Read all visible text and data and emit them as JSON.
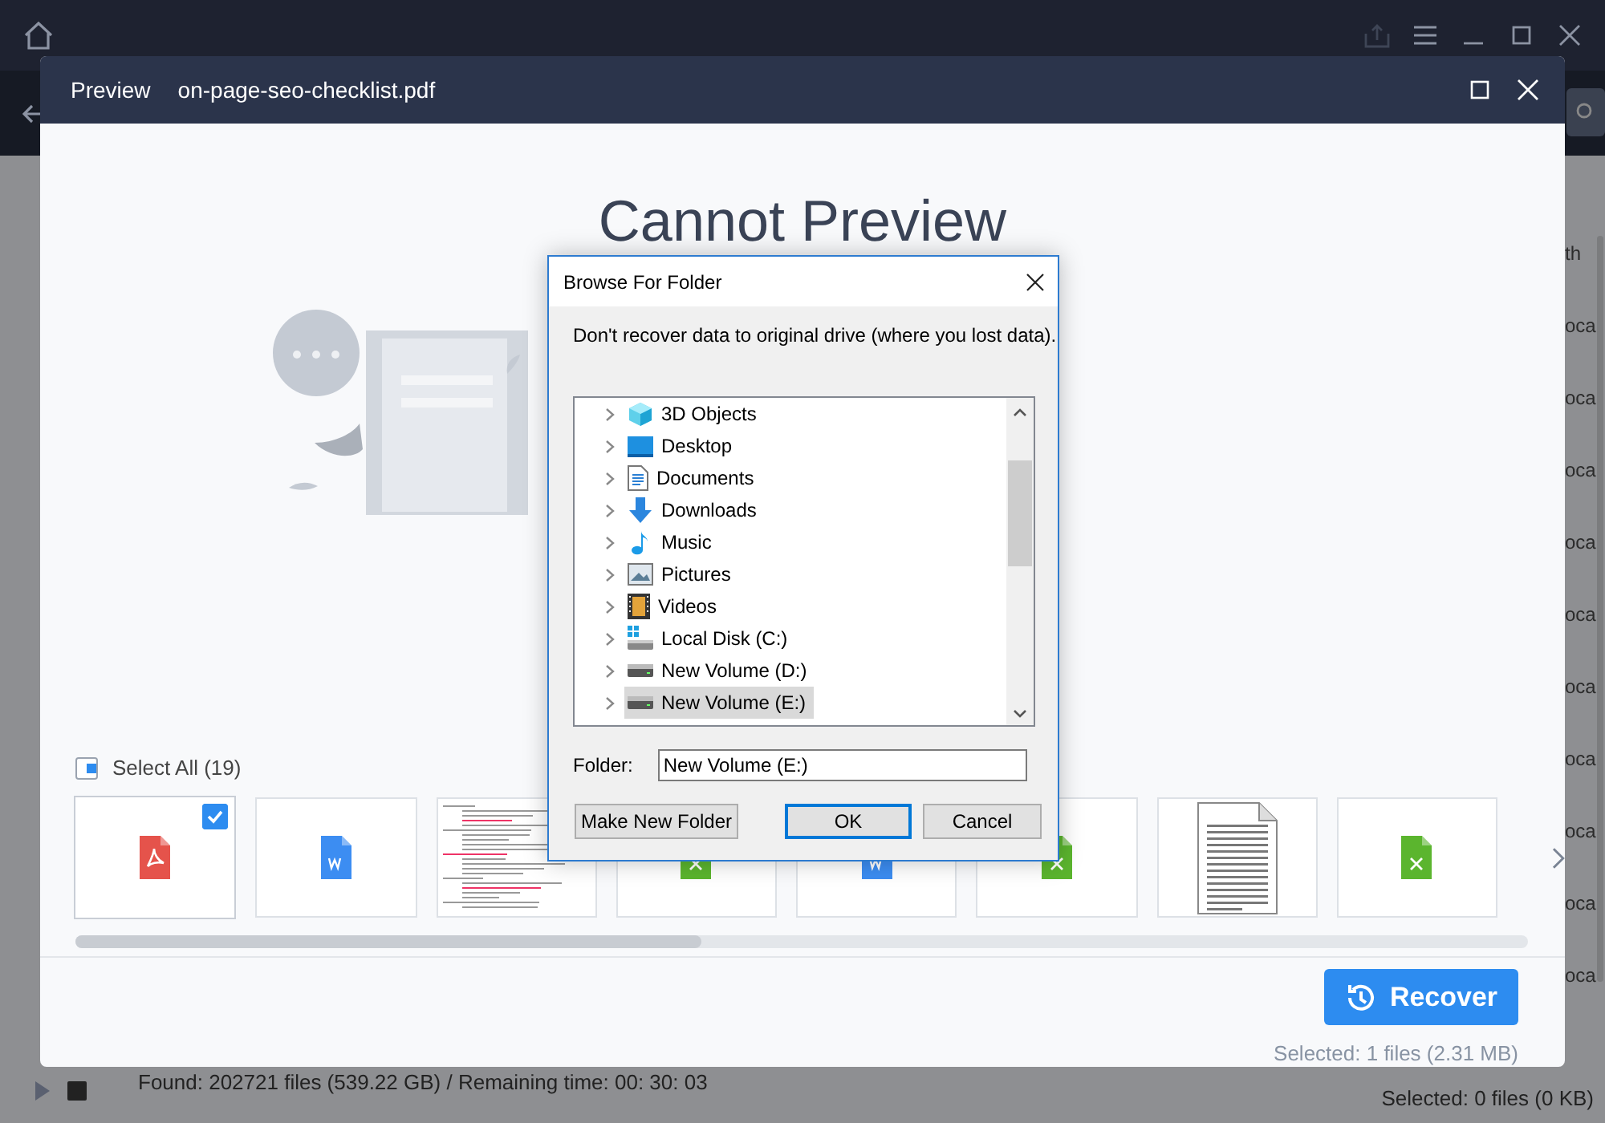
{
  "app": {
    "status": "Found: 202721 files (539.22 GB) / Remaining time: 00: 30: 03",
    "selected_summary": "Selected: 0 files (0 KB)",
    "column_heading": "th",
    "rows": [
      "oca",
      "oca",
      "oca",
      "oca",
      "oca",
      "oca",
      "oca",
      "oca",
      "oca",
      "oca"
    ]
  },
  "preview": {
    "title": "Preview",
    "file_name": "on-page-seo-checklist.pdf",
    "message": "Cannot Preview",
    "select_all": {
      "label": "Select All (19)",
      "indeterminate": true
    },
    "thumbnails": [
      {
        "kind": "pdf",
        "checked": true
      },
      {
        "kind": "word",
        "checked": false
      },
      {
        "kind": "page",
        "checked": false
      },
      {
        "kind": "excel",
        "checked": false
      },
      {
        "kind": "word",
        "checked": false
      },
      {
        "kind": "excel",
        "checked": false
      },
      {
        "kind": "text",
        "checked": false
      },
      {
        "kind": "excel",
        "checked": false
      }
    ],
    "recover_button": "Recover",
    "selected_summary": "Selected: 1 files (2.31 MB)"
  },
  "dialog": {
    "title": "Browse For Folder",
    "message": "Don't recover data to original drive (where you lost data).",
    "tree": [
      {
        "label": "3D Objects",
        "kind": "objects",
        "selected": false
      },
      {
        "label": "Desktop",
        "kind": "desktop",
        "selected": false
      },
      {
        "label": "Documents",
        "kind": "documents",
        "selected": false
      },
      {
        "label": "Downloads",
        "kind": "downloads",
        "selected": false
      },
      {
        "label": "Music",
        "kind": "music",
        "selected": false
      },
      {
        "label": "Pictures",
        "kind": "pictures",
        "selected": false
      },
      {
        "label": "Videos",
        "kind": "videos",
        "selected": false
      },
      {
        "label": "Local Disk (C:)",
        "kind": "system-disk",
        "selected": false
      },
      {
        "label": "New Volume (D:)",
        "kind": "disk",
        "selected": false
      },
      {
        "label": "New Volume (E:)",
        "kind": "disk",
        "selected": true
      }
    ],
    "folder_label": "Folder:",
    "folder_value": "New Volume (E:)",
    "buttons": [
      {
        "label": "Make New Folder",
        "kind": "normal"
      },
      {
        "label": "OK",
        "kind": "default"
      },
      {
        "label": "Cancel",
        "kind": "normal"
      }
    ]
  }
}
